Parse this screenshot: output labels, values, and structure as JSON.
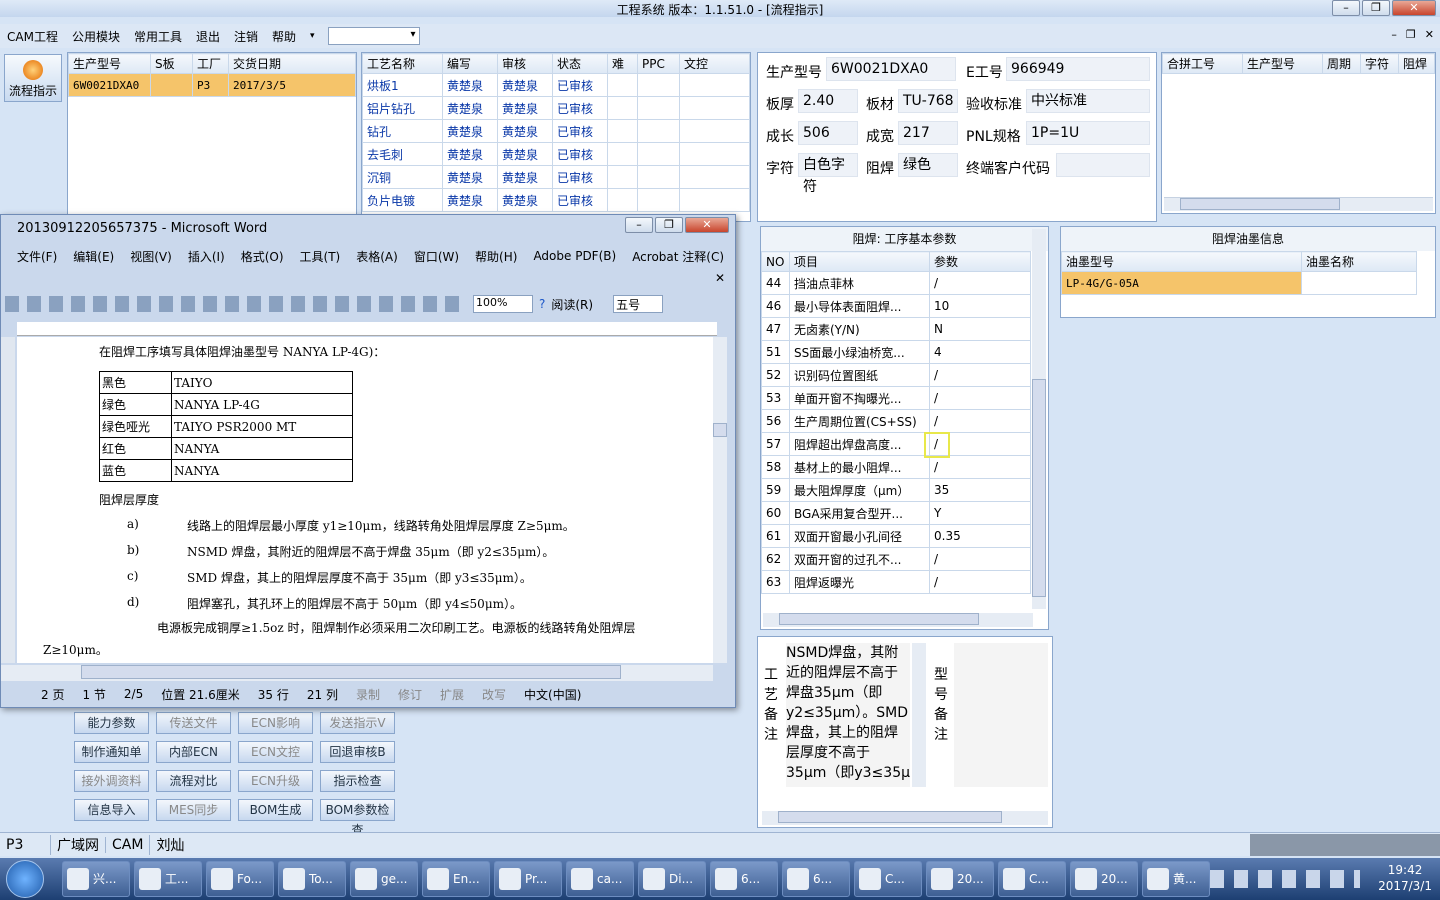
{
  "window": {
    "title": "工程系统   版本：1.1.51.0 - [流程指示]"
  },
  "menu": [
    "CAM工程",
    "公用模块",
    "常用工具",
    "退出",
    "注销",
    "帮助"
  ],
  "side_button": "流程指示",
  "orders": {
    "headers": [
      "生产型号",
      "S板",
      "工厂",
      "交货日期"
    ],
    "row": [
      "6W0021DXA0",
      "",
      "P3",
      "2017/3/5"
    ]
  },
  "process": {
    "headers": [
      "工艺名称",
      "编写",
      "审核",
      "状态",
      "难",
      "PPC",
      "文控"
    ],
    "rows": [
      [
        "烘板1",
        "黄楚泉",
        "黄楚泉",
        "已审核"
      ],
      [
        "铝片钻孔",
        "黄楚泉",
        "黄楚泉",
        "已审核"
      ],
      [
        "钻孔",
        "黄楚泉",
        "黄楚泉",
        "已审核"
      ],
      [
        "去毛刺",
        "黄楚泉",
        "黄楚泉",
        "已审核"
      ],
      [
        "沉铜",
        "黄楚泉",
        "黄楚泉",
        "已审核"
      ],
      [
        "负片电镀",
        "黄楚泉",
        "黄楚泉",
        "已审核"
      ]
    ]
  },
  "info": {
    "model_lbl": "生产型号",
    "model": "6W0021DXA0",
    "e_lbl": "E工号",
    "e": "966949",
    "thick_lbl": "板厚",
    "thick": "2.40",
    "mat_lbl": "板材",
    "mat": "TU-768",
    "acc_lbl": "验收标准",
    "acc": "中兴标准",
    "len_lbl": "成长",
    "len": "506",
    "wid_lbl": "成宽",
    "wid": "217",
    "pnl_lbl": "PNL规格",
    "pnl": "1P=1U",
    "char_lbl": "字符",
    "char": "白色字符",
    "mask_lbl": "阻焊",
    "mask": "绿色",
    "end_lbl": "终端客户代码",
    "end": ""
  },
  "combine": {
    "headers": [
      "合拼工号",
      "生产型号",
      "周期",
      "字符",
      "阻焊"
    ]
  },
  "params": {
    "title": "阻焊: 工序基本参数",
    "headers": [
      "NO",
      "项目",
      "参数"
    ],
    "rows": [
      [
        "44",
        "挡油点菲林",
        "/"
      ],
      [
        "46",
        "最小导体表面阻焊...",
        "10"
      ],
      [
        "47",
        "无卤素(Y/N)",
        "N"
      ],
      [
        "51",
        "SS面最小绿油桥宽...",
        "4"
      ],
      [
        "52",
        "识别码位置图纸",
        "/"
      ],
      [
        "53",
        "单面开窗不掏曝光...",
        "/"
      ],
      [
        "56",
        "生产周期位置(CS+SS)",
        "/"
      ],
      [
        "57",
        "阻焊超出焊盘高度...",
        "/"
      ],
      [
        "58",
        "基材上的最小阻焊...",
        "/"
      ],
      [
        "59",
        "最大阻焊厚度（μm）",
        "35"
      ],
      [
        "60",
        "BGA采用复合型开...",
        "Y"
      ],
      [
        "61",
        "双面开窗最小孔间径",
        "0.35"
      ],
      [
        "62",
        "双面开窗的过孔不...",
        "/"
      ],
      [
        "63",
        "阻焊返曝光",
        "/"
      ]
    ]
  },
  "ink": {
    "title": "阻焊油墨信息",
    "headers": [
      "油墨型号",
      "油墨名称"
    ],
    "row": [
      "LP-4G/G-05A",
      ""
    ]
  },
  "remark": {
    "label": "工艺备注",
    "text": "NSMD焊盘，其附近的阻焊层不高于焊盘35μm（即y2≤35μm）。SMD焊盘，其上的阻焊层厚度不高于35μm（即y3≤35μ",
    "label2": "型号备注"
  },
  "buttons": [
    [
      "能力参数",
      "传送文件",
      "ECN影响",
      "发送指示V"
    ],
    [
      "制作通知单",
      "内部ECN",
      "ECN文控",
      "回退审核B"
    ],
    [
      "接外调资料",
      "流程对比",
      "ECN升级",
      "指示检查"
    ],
    [
      "信息导入",
      "MES同步",
      "BOM生成",
      "BOM参数检查"
    ]
  ],
  "status": {
    "factory": "P3",
    "items": [
      "广域网",
      "CAM",
      "刘灿"
    ]
  },
  "word": {
    "title": "20130912205657375 - Microsoft Word",
    "menu": [
      "文件(F)",
      "编辑(E)",
      "视图(V)",
      "插入(I)",
      "格式(O)",
      "工具(T)",
      "表格(A)",
      "窗口(W)",
      "帮助(H)",
      "Adobe PDF(B)",
      "Acrobat 注释(C)"
    ],
    "zoom": "100%",
    "read": "阅读(R)",
    "font_size": "五号",
    "line1": "在阻焊工序填写具体阻焊油墨型号 NANYA  LP-4G)：",
    "colors": [
      [
        "黑色",
        "TAIYO"
      ],
      [
        "绿色",
        "NANYA  LP-4G"
      ],
      [
        "绿色哑光",
        "TAIYO  PSR2000 MT"
      ],
      [
        "红色",
        "NANYA"
      ],
      [
        "蓝色",
        "NANYA"
      ]
    ],
    "heading": "阻焊层厚度",
    "items": [
      [
        "a)",
        "线路上的阻焊层最小厚度 y1≥10μm，线路转角处阻焊层厚度 Z≥5μm。"
      ],
      [
        "b)",
        "NSMD 焊盘，其附近的阻焊层不高于焊盘 35μm（即 y2≤35μm）。"
      ],
      [
        "c)",
        "SMD 焊盘，其上的阻焊层厚度不高于 35μm（即 y3≤35μm）。"
      ],
      [
        "d)",
        "阻焊塞孔，其孔环上的阻焊层不高于 50μm（即 y4≤50μm）。"
      ]
    ],
    "para": "电源板完成铜厚≥1.5oz 时，阻焊制作必须采用二次印刷工艺。电源板的线路转角处阻焊层",
    "para2": "Z≥10μm。",
    "status": [
      "2 页",
      "1 节",
      "2/5",
      "位置 21.6厘米",
      "35 行",
      "21 列",
      "录制",
      "修订",
      "扩展",
      "改写",
      "中文(中国)"
    ]
  },
  "taskbar": {
    "items": [
      "兴...",
      "工...",
      "Fo...",
      "To...",
      "ge...",
      "En...",
      "Pr...",
      "ca...",
      "Di...",
      "6...",
      "6...",
      "C...",
      "20...",
      "C...",
      "20...",
      "黄..."
    ],
    "time": "19:42",
    "date": "2017/3/1"
  }
}
